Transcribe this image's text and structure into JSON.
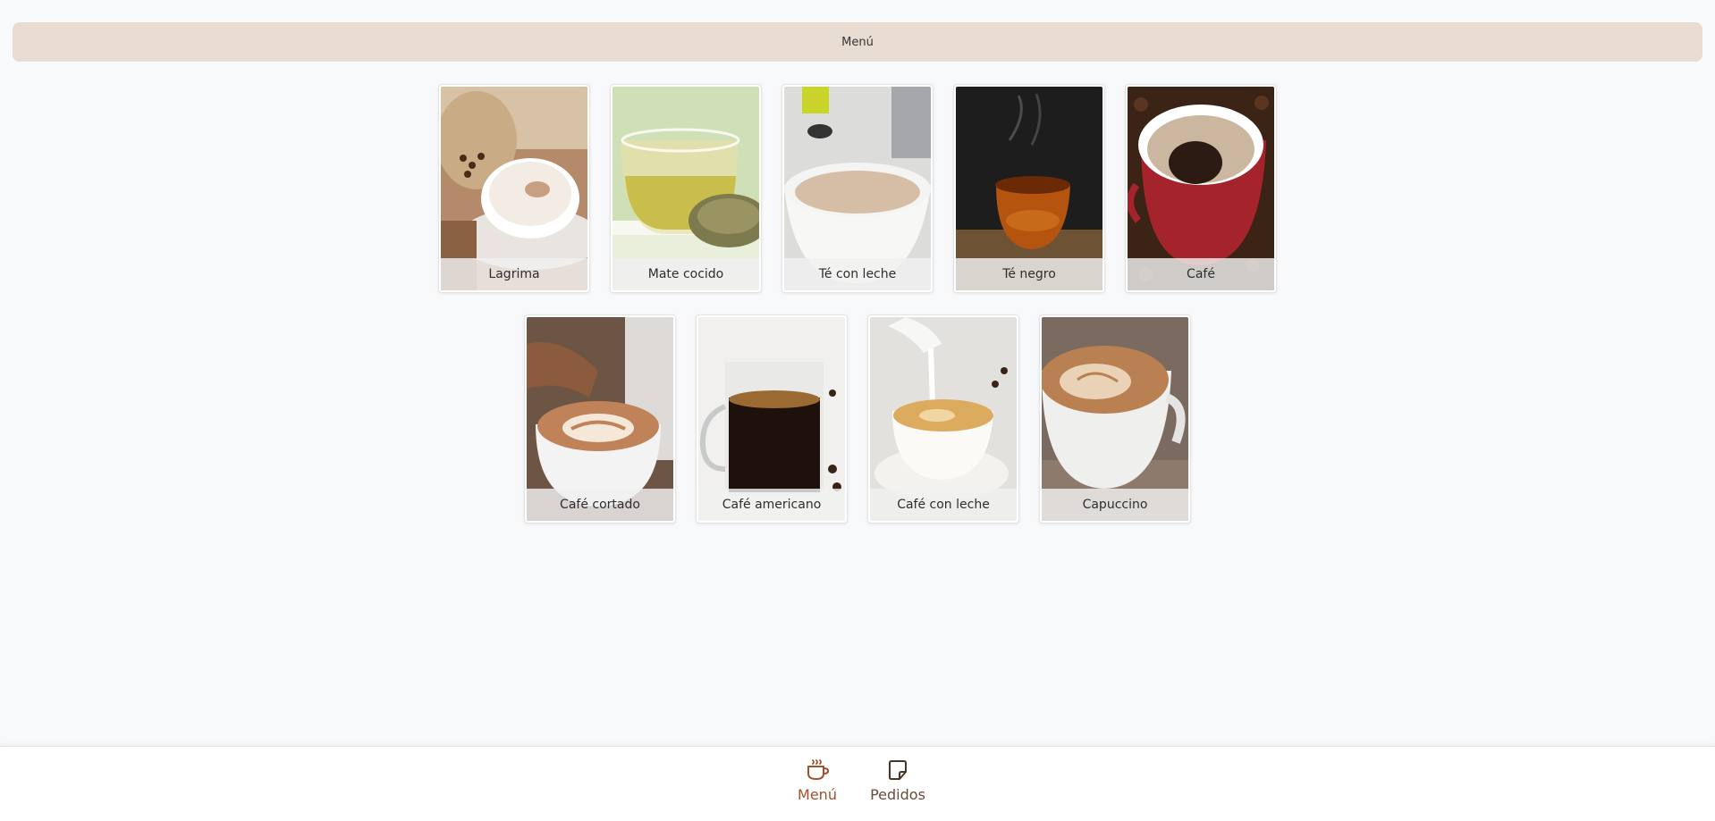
{
  "header": {
    "title": "Menú"
  },
  "menu": {
    "rows": [
      [
        {
          "id": "lagrima",
          "label": "Lagrima",
          "palette": "cappuccino-beans"
        },
        {
          "id": "mate-cocido",
          "label": "Mate cocido",
          "palette": "green-tea"
        },
        {
          "id": "te-con-leche",
          "label": "Té con leche",
          "palette": "milk-tea"
        },
        {
          "id": "te-negro",
          "label": "Té negro",
          "palette": "black-tea"
        },
        {
          "id": "cafe",
          "label": "Café",
          "palette": "red-cup"
        }
      ],
      [
        {
          "id": "cafe-cortado",
          "label": "Café cortado",
          "palette": "latte-art"
        },
        {
          "id": "cafe-americano",
          "label": "Café americano",
          "palette": "glass-coffee"
        },
        {
          "id": "cafe-con-leche",
          "label": "Café con leche",
          "palette": "milk-pour"
        },
        {
          "id": "capuccino",
          "label": "Capuccino",
          "palette": "capuccino"
        }
      ]
    ]
  },
  "bottom_nav": {
    "items": [
      {
        "id": "menu",
        "label": "Menú",
        "icon": "coffee-cup-icon",
        "active": true
      },
      {
        "id": "pedidos",
        "label": "Pedidos",
        "icon": "note-icon",
        "active": false
      }
    ]
  },
  "colors": {
    "accent": "#a0522d",
    "header_bg": "#e7dbd2",
    "page_bg": "#f8f9fb"
  }
}
